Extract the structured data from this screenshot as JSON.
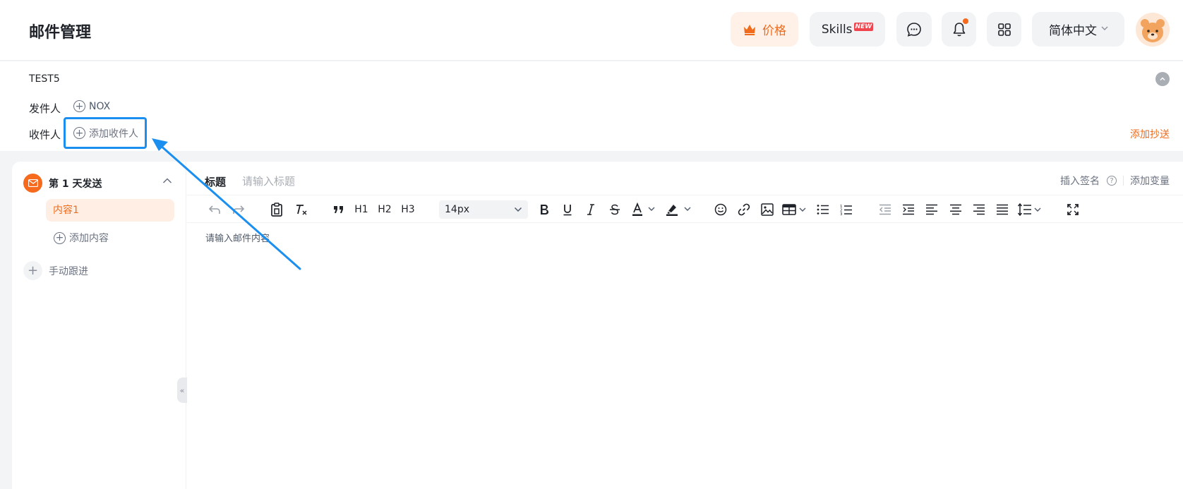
{
  "header": {
    "title": "邮件管理",
    "price_label": "价格",
    "skills_label": "Skills",
    "new_badge": "NEW",
    "language": "简体中文"
  },
  "meta": {
    "subject": "TEST5",
    "sender_label": "发件人",
    "sender_value": "NOX",
    "recipient_label": "收件人",
    "add_recipient": "添加收件人",
    "add_cc": "添加抄送"
  },
  "sidebar": {
    "day_label": "第 1 天发送",
    "content_item": "内容1",
    "add_content": "添加内容",
    "manual_follow": "手动跟进",
    "toggle_glyph": "«"
  },
  "editor": {
    "title_label": "标题",
    "title_placeholder": "请输入标题",
    "insert_signature": "插入签名",
    "add_variable": "添加变量",
    "body_placeholder": "请输入邮件内容",
    "font_size": "14px",
    "toolbar_labels": {
      "h1": "H1",
      "h2": "H2",
      "h3": "H3"
    }
  },
  "colors": {
    "accent": "#f06b1b",
    "highlight_box": "#1a8ff0",
    "annotation_arrow": "#1a8ff0"
  }
}
